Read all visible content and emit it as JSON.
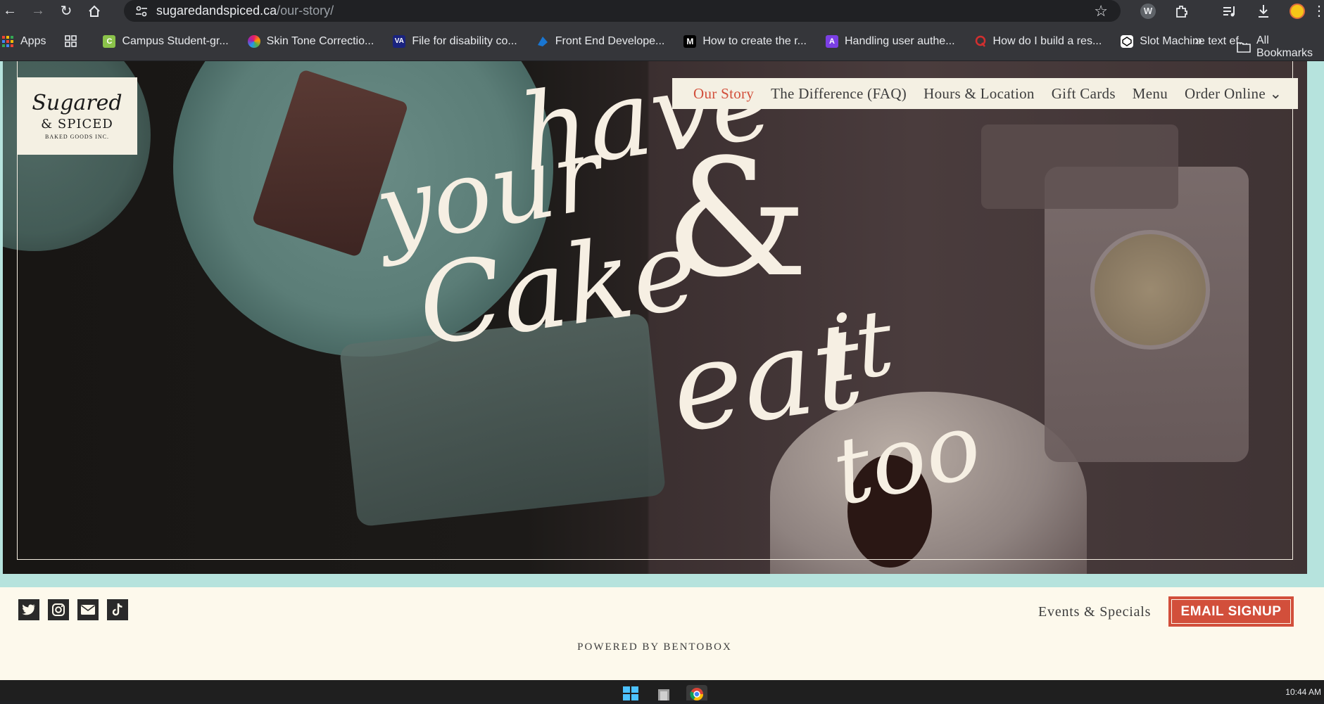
{
  "browser": {
    "url_host": "sugaredandspiced.ca",
    "url_path": "/our-story/",
    "bookmarks": [
      {
        "label": "Apps",
        "icon": "apps-grid-icon",
        "color": "#ea4335"
      },
      {
        "label": "",
        "icon": "tab-groups-icon",
        "color": "#e8eaed"
      },
      {
        "label": "Campus Student-gr...",
        "icon": "c-favicon",
        "color": "#8bc34a"
      },
      {
        "label": "Skin Tone Correctio...",
        "icon": "color-wheel-favicon",
        "color": "#e91e63"
      },
      {
        "label": "File for disability co...",
        "icon": "va-favicon",
        "color": "#1a237e"
      },
      {
        "label": "Front End Develope...",
        "icon": "meta-favicon",
        "color": "#1976d2"
      },
      {
        "label": "How to create the r...",
        "icon": "medium-favicon",
        "color": "#000000"
      },
      {
        "label": "Handling user authe...",
        "icon": "a-favicon",
        "color": "#7b3fe4"
      },
      {
        "label": "How do I build a res...",
        "icon": "quora-favicon",
        "color": "#b92b27"
      },
      {
        "label": "Slot Machine text ef...",
        "icon": "codepen-favicon",
        "color": "#ffffff"
      }
    ],
    "all_bookmarks": "All Bookmarks"
  },
  "site": {
    "logo": {
      "line1": "Sugared",
      "line2": "& SPICED",
      "line3": "BAKED GOODS INC."
    },
    "nav": [
      {
        "label": "Our Story",
        "active": true
      },
      {
        "label": "The Difference (FAQ)",
        "active": false
      },
      {
        "label": "Hours & Location",
        "active": false
      },
      {
        "label": "Gift Cards",
        "active": false
      },
      {
        "label": "Menu",
        "active": false
      },
      {
        "label": "Order Online ⌄",
        "active": false
      }
    ],
    "hero_words": {
      "have": "have",
      "your": "your",
      "cake": "Cake",
      "amp": "&",
      "eat": "eat",
      "it": "it",
      "too": "too"
    }
  },
  "footer": {
    "social": [
      "twitter-icon",
      "instagram-icon",
      "email-icon",
      "tiktok-icon"
    ],
    "events_link": "Events & Specials",
    "signup_button": "EMAIL SIGNUP",
    "powered_by": "POWERED BY BENTOBOX"
  },
  "taskbar": {
    "time": "10:44 AM"
  },
  "colors": {
    "accent": "#d24f3b",
    "cream": "#f4f0e3",
    "teal": "#b6e3dd"
  }
}
